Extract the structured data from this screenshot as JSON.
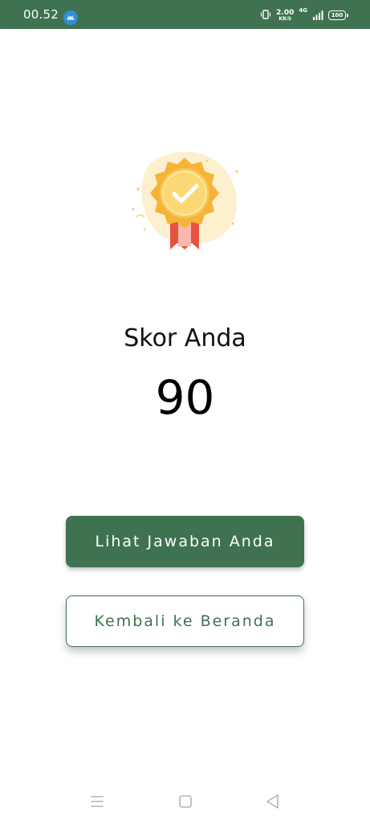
{
  "status_bar": {
    "time": "00.52",
    "net_speed_value": "2.00",
    "net_speed_unit": "KB/S",
    "network_type": "4G",
    "battery": "100",
    "background_color": "#3e7250"
  },
  "result": {
    "badge_icon": "medal-checkmark-icon",
    "score_label": "Skor Anda",
    "score_value": "90"
  },
  "actions": {
    "primary_label": "Lihat Jawaban Anda",
    "secondary_label": "Kembali ke Beranda",
    "accent_color": "#3e7250"
  },
  "nav_bar": {
    "icons": [
      "menu-icon",
      "home-icon",
      "back-icon"
    ]
  }
}
